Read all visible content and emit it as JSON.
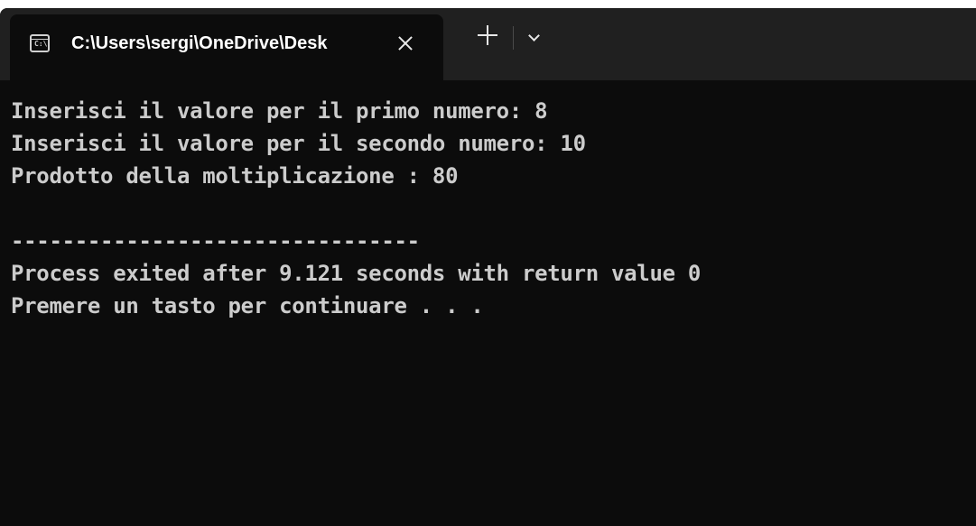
{
  "tab": {
    "icon": "console-app-icon",
    "icon_glyph": "C:\\",
    "title": "C:\\Users\\sergi\\OneDrive\\Desk",
    "close_icon": "close-icon",
    "new_tab_icon": "plus-icon",
    "dropdown_icon": "chevron-down-icon"
  },
  "console": {
    "lines": [
      "Inserisci il valore per il primo numero: 8",
      "Inserisci il valore per il secondo numero: 10",
      "Prodotto della moltiplicazione : 80",
      "",
      "--------------------------------",
      "Process exited after 9.121 seconds with return value 0",
      "Premere un tasto per continuare . . ."
    ]
  },
  "colors": {
    "background": "#0c0c0c",
    "tabbar": "#202020",
    "text": "#cccccc"
  }
}
